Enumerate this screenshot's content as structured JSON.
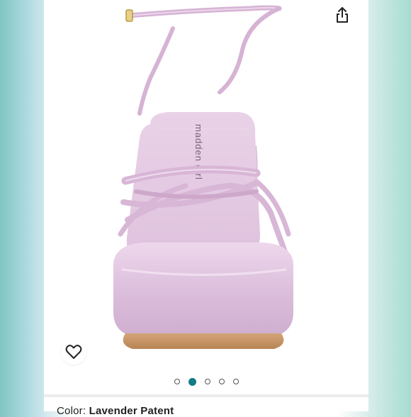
{
  "product": {
    "image_alt": "",
    "brand_imprint": "madden girl",
    "color_label": "Color:",
    "color_value": "Lavender Patent"
  },
  "actions": {
    "share_icon": "share-icon",
    "favorite_icon": "heart-outline-icon"
  },
  "carousel": {
    "total": 5,
    "active_index": 1
  },
  "colors": {
    "accent": "#127b86",
    "shoe": "#e3c6e2"
  }
}
